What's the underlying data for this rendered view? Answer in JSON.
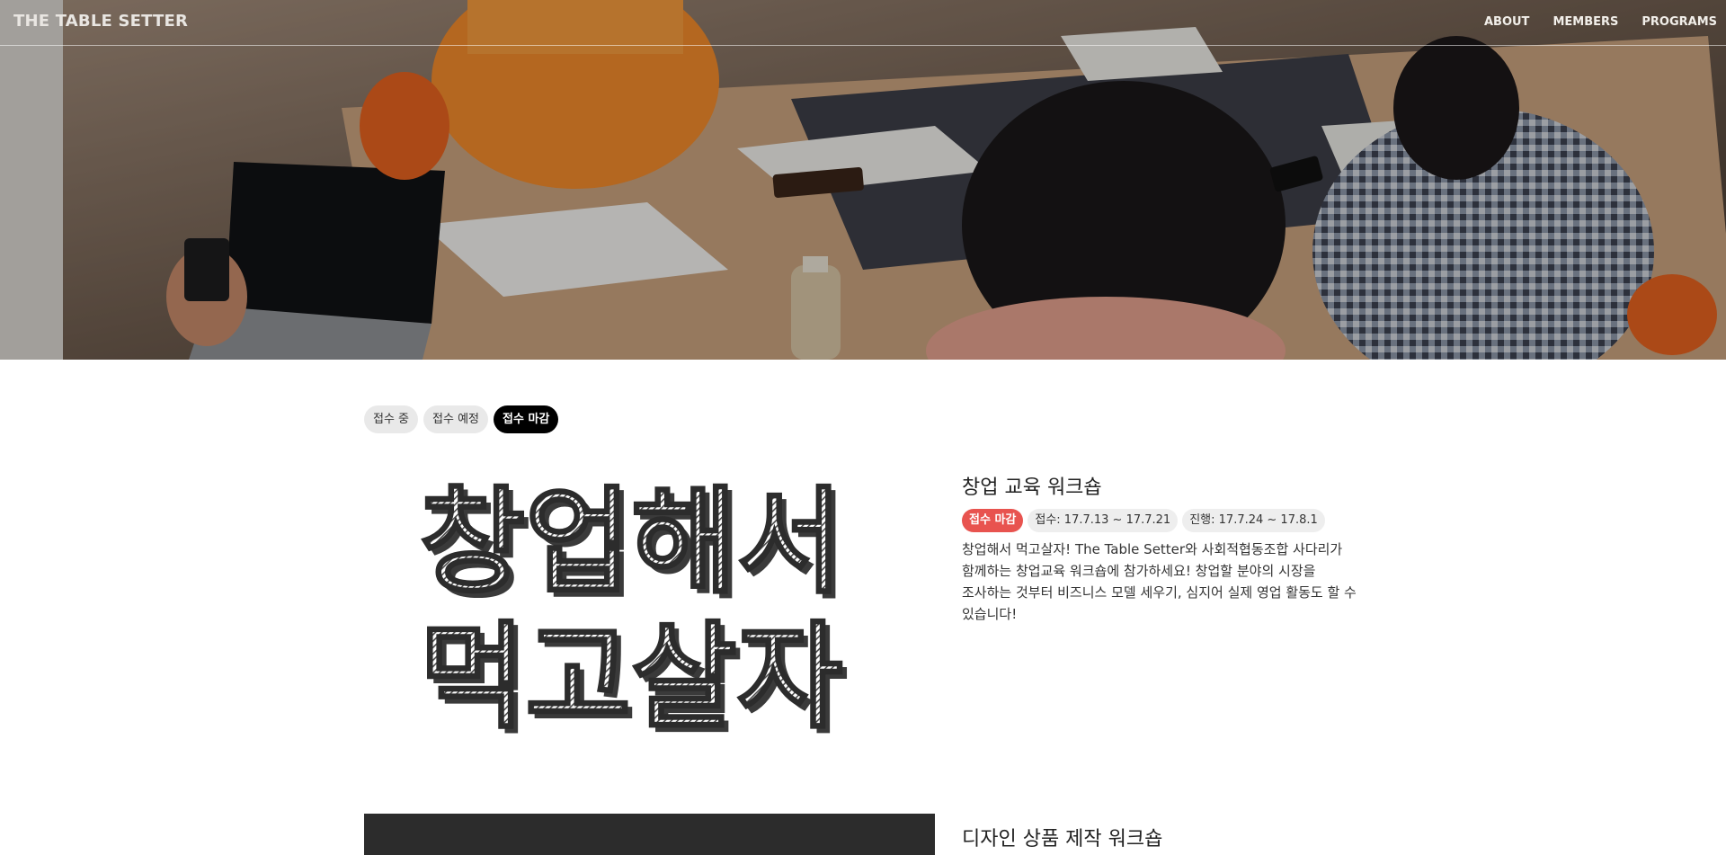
{
  "header": {
    "brand": "THE TABLE SETTER",
    "nav": [
      "ABOUT",
      "MEMBERS",
      "PROGRAMS"
    ]
  },
  "filters": {
    "items": [
      "접수 중",
      "접수 예정",
      "접수 마감"
    ],
    "active_index": 2
  },
  "programs": [
    {
      "title": "창업 교육 워크숍",
      "status": "접수 마감",
      "apply_period": "접수: 17.7.13 ~ 17.7.21",
      "run_period": "진행: 17.7.24 ~ 17.8.1",
      "description": "창업해서 먹고살자! The Table Setter와 사회적협동조합 사다리가 함께하는 창업교육 워크숍에 참가하세요! 창업할 분야의 시장을 조사하는 것부터 비즈니스 모델 세우기, 심지어 실제 영업 활동도 할 수 있습니다!",
      "poster_text": [
        "창업해서",
        "먹고살자"
      ]
    },
    {
      "title": "디자인 상품 제작 워크숍"
    }
  ],
  "colors": {
    "status_closed": "#e8534f",
    "active_filter": "#000000",
    "chip_bg": "#e9e9e9"
  }
}
